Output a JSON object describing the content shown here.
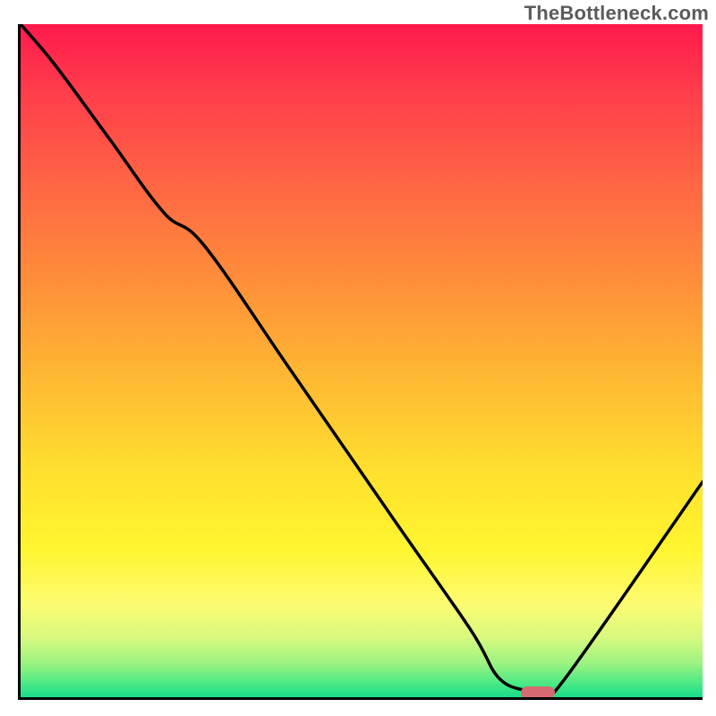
{
  "watermark": "TheBottleneck.com",
  "colors": {
    "gradient_top": "#ff1a4d",
    "gradient_mid": "#ffd52f",
    "gradient_bottom": "#17dd8a",
    "curve": "#000000",
    "marker": "#d56a72",
    "axis": "#000000"
  },
  "chart_data": {
    "type": "line",
    "title": "",
    "xlabel": "",
    "ylabel": "",
    "xlim": [
      0,
      100
    ],
    "ylim": [
      0,
      100
    ],
    "x": [
      0,
      5,
      13,
      21,
      27,
      40,
      55,
      66,
      70,
      74,
      77,
      80,
      100
    ],
    "values": [
      100,
      94,
      83,
      72,
      67,
      48,
      26,
      10,
      3,
      1,
      1,
      3,
      32
    ],
    "marker": {
      "x": 75.5,
      "y": 1
    },
    "note": "Values are read from the plot in percent of axis range; the curve starts at the top-left, descends steeply, bottoms near x≈75, then rises toward the right edge."
  }
}
